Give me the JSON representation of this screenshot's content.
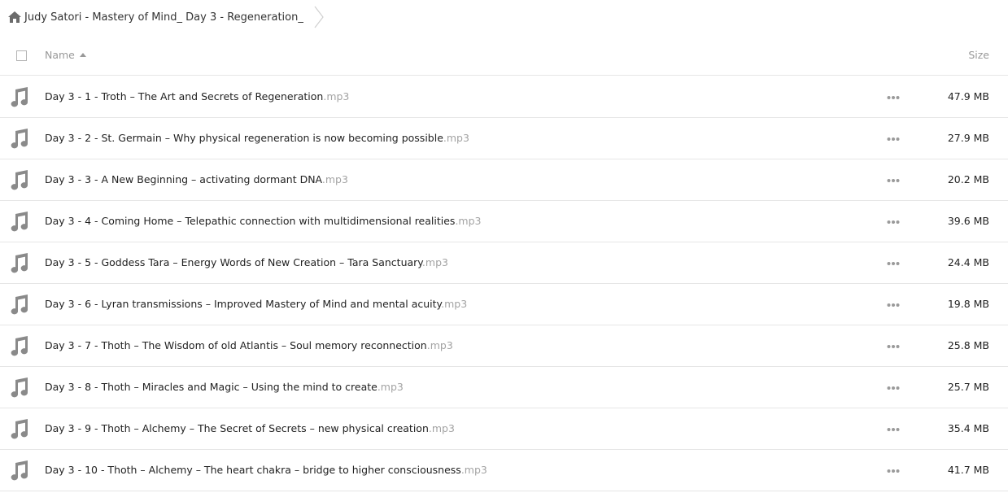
{
  "breadcrumb": {
    "icon": "home-icon",
    "folder": "Judy Satori - Mastery of Mind_ Day 3 - Regeneration_"
  },
  "header": {
    "name_label": "Name",
    "size_label": "Size"
  },
  "files": [
    {
      "name": "Day 3 - 1 - Troth – The Art and Secrets of Regeneration",
      "ext": ".mp3",
      "size": "47.9 MB"
    },
    {
      "name": "Day 3 - 2 - St. Germain – Why physical regeneration is now becoming possible",
      "ext": ".mp3",
      "size": "27.9 MB"
    },
    {
      "name": "Day 3 - 3 - A New Beginning – activating dormant DNA",
      "ext": ".mp3",
      "size": "20.2 MB"
    },
    {
      "name": "Day 3 - 4 - Coming Home – Telepathic connection with multidimensional realities",
      "ext": ".mp3",
      "size": "39.6 MB"
    },
    {
      "name": "Day 3 - 5 - Goddess Tara – Energy Words of New Creation – Tara Sanctuary",
      "ext": ".mp3",
      "size": "24.4 MB"
    },
    {
      "name": "Day 3 - 6 - Lyran transmissions – Improved Mastery of Mind and mental acuity",
      "ext": ".mp3",
      "size": "19.8 MB"
    },
    {
      "name": "Day 3 - 7 - Thoth – The Wisdom of old Atlantis – Soul memory reconnection",
      "ext": ".mp3",
      "size": "25.8 MB"
    },
    {
      "name": "Day 3 - 8 - Thoth – Miracles and Magic – Using the mind to create",
      "ext": ".mp3",
      "size": "25.7 MB"
    },
    {
      "name": "Day 3 - 9 - Thoth – Alchemy – The Secret of Secrets – new physical creation",
      "ext": ".mp3",
      "size": "35.4 MB"
    },
    {
      "name": "Day 3 - 10 - Thoth – Alchemy – The heart chakra – bridge to higher consciousness",
      "ext": ".mp3",
      "size": "41.7 MB"
    }
  ],
  "icons": {
    "file": "music-note-icon",
    "more": "more-options-icon"
  },
  "colors": {
    "icon_gray": "#8a8a8a",
    "extension_gray": "#a3a3a3",
    "divider": "#e6e6e6"
  }
}
